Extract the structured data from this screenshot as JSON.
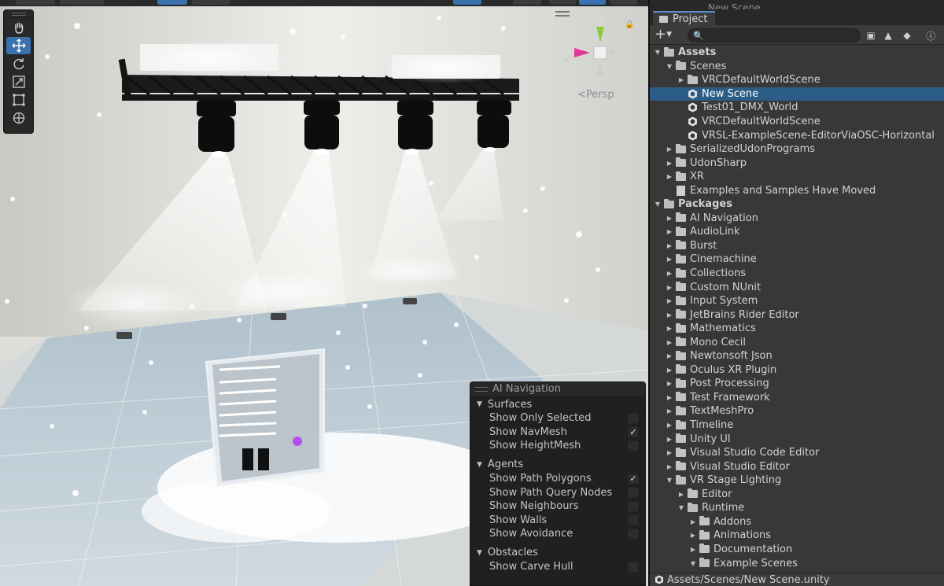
{
  "scene": {
    "persp_label": "<Persp",
    "gizmo_axis_y": "y",
    "tools": [
      {
        "name": "hand-tool",
        "icon": "hand-icon"
      },
      {
        "name": "move-tool",
        "icon": "move-icon",
        "active": true
      },
      {
        "name": "rotate-tool",
        "icon": "rotate-icon"
      },
      {
        "name": "scale-tool",
        "icon": "scale-icon"
      },
      {
        "name": "rect-tool",
        "icon": "rect-icon"
      },
      {
        "name": "transform-tool",
        "icon": "transform-icon"
      }
    ],
    "control_panel": {
      "labels": [
        "Master/Final Intensity",
        "Master Intensity",
        "Fog Intensity",
        "Rim Intensity",
        "Flare Intensity",
        "Dimmer Intensity",
        "Global Intensity"
      ],
      "values": [
        "0",
        "0",
        "0",
        "0",
        "0",
        "0",
        "0"
      ],
      "logo": "VRSL"
    }
  },
  "ai_navigation": {
    "title": "AI Navigation",
    "sections": [
      {
        "title": "Surfaces",
        "options": [
          {
            "label": "Show Only Selected",
            "checked": false
          },
          {
            "label": "Show NavMesh",
            "checked": true
          },
          {
            "label": "Show HeightMesh",
            "checked": false
          }
        ]
      },
      {
        "title": "Agents",
        "options": [
          {
            "label": "Show Path Polygons",
            "checked": true
          },
          {
            "label": "Show Path Query Nodes",
            "checked": false
          },
          {
            "label": "Show Neighbours",
            "checked": false
          },
          {
            "label": "Show Walls",
            "checked": false
          },
          {
            "label": "Show Avoidance",
            "checked": false
          }
        ]
      },
      {
        "title": "Obstacles",
        "options": [
          {
            "label": "Show Carve Hull",
            "checked": false
          }
        ]
      }
    ],
    "checkmark": "✓"
  },
  "project": {
    "tab_label": "Project",
    "ghost_tab": "New Scene",
    "search_placeholder": "",
    "status_path": "Assets/Scenes/New Scene.unity",
    "tree": [
      {
        "label": "Assets",
        "depth": 0,
        "type": "folder",
        "open": true,
        "bold": true
      },
      {
        "label": "Scenes",
        "depth": 1,
        "type": "folder",
        "open": true
      },
      {
        "label": "VRCDefaultWorldScene",
        "depth": 2,
        "type": "folder",
        "open": false
      },
      {
        "label": "New Scene",
        "depth": 2,
        "type": "scene",
        "selected": true
      },
      {
        "label": "Test01_DMX_World",
        "depth": 2,
        "type": "scene"
      },
      {
        "label": "VRCDefaultWorldScene",
        "depth": 2,
        "type": "scene"
      },
      {
        "label": "VRSL-ExampleScene-EditorViaOSC-Horizontal",
        "depth": 2,
        "type": "scene"
      },
      {
        "label": "SerializedUdonPrograms",
        "depth": 1,
        "type": "folder",
        "open": false
      },
      {
        "label": "UdonSharp",
        "depth": 1,
        "type": "folder",
        "open": false
      },
      {
        "label": "XR",
        "depth": 1,
        "type": "folder",
        "open": false
      },
      {
        "label": "Examples and Samples Have Moved",
        "depth": 1,
        "type": "doc"
      },
      {
        "label": "Packages",
        "depth": 0,
        "type": "folder",
        "open": true,
        "bold": true
      },
      {
        "label": "AI Navigation",
        "depth": 1,
        "type": "folder",
        "open": false
      },
      {
        "label": "AudioLink",
        "depth": 1,
        "type": "folder",
        "open": false
      },
      {
        "label": "Burst",
        "depth": 1,
        "type": "folder",
        "open": false
      },
      {
        "label": "Cinemachine",
        "depth": 1,
        "type": "folder",
        "open": false
      },
      {
        "label": "Collections",
        "depth": 1,
        "type": "folder",
        "open": false
      },
      {
        "label": "Custom NUnit",
        "depth": 1,
        "type": "folder",
        "open": false
      },
      {
        "label": "Input System",
        "depth": 1,
        "type": "folder",
        "open": false
      },
      {
        "label": "JetBrains Rider Editor",
        "depth": 1,
        "type": "folder",
        "open": false
      },
      {
        "label": "Mathematics",
        "depth": 1,
        "type": "folder",
        "open": false
      },
      {
        "label": "Mono Cecil",
        "depth": 1,
        "type": "folder",
        "open": false
      },
      {
        "label": "Newtonsoft Json",
        "depth": 1,
        "type": "folder",
        "open": false
      },
      {
        "label": "Oculus XR Plugin",
        "depth": 1,
        "type": "folder",
        "open": false
      },
      {
        "label": "Post Processing",
        "depth": 1,
        "type": "folder",
        "open": false
      },
      {
        "label": "Test Framework",
        "depth": 1,
        "type": "folder",
        "open": false
      },
      {
        "label": "TextMeshPro",
        "depth": 1,
        "type": "folder",
        "open": false
      },
      {
        "label": "Timeline",
        "depth": 1,
        "type": "folder",
        "open": false
      },
      {
        "label": "Unity UI",
        "depth": 1,
        "type": "folder",
        "open": false
      },
      {
        "label": "Visual Studio Code Editor",
        "depth": 1,
        "type": "folder",
        "open": false
      },
      {
        "label": "Visual Studio Editor",
        "depth": 1,
        "type": "folder",
        "open": false
      },
      {
        "label": "VR Stage Lighting",
        "depth": 1,
        "type": "folder",
        "open": true
      },
      {
        "label": "Editor",
        "depth": 2,
        "type": "folder",
        "open": false
      },
      {
        "label": "Runtime",
        "depth": 2,
        "type": "folder",
        "open": true
      },
      {
        "label": "Addons",
        "depth": 3,
        "type": "folder",
        "open": false
      },
      {
        "label": "Animations",
        "depth": 3,
        "type": "folder",
        "open": false
      },
      {
        "label": "Documentation",
        "depth": 3,
        "type": "folder",
        "open": false
      },
      {
        "label": "Example Scenes",
        "depth": 3,
        "type": "folder",
        "open": true
      }
    ]
  }
}
